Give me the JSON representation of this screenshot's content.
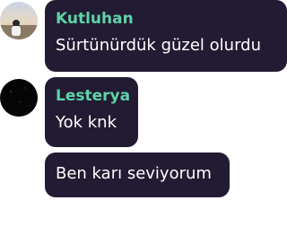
{
  "messages": [
    {
      "author": "Kutluhan",
      "text": "Sürtünürdük güzel olurdu",
      "avatar": "user-photo-avatar"
    },
    {
      "author": "Lesterya",
      "text": "Yok knk",
      "avatar": "dark-avatar"
    },
    {
      "author": "",
      "text": "Ben karı seviyorum",
      "avatar": ""
    }
  ],
  "colors": {
    "bubble": "#221b33",
    "username": "#5fd3a6",
    "text": "#ffffff"
  }
}
